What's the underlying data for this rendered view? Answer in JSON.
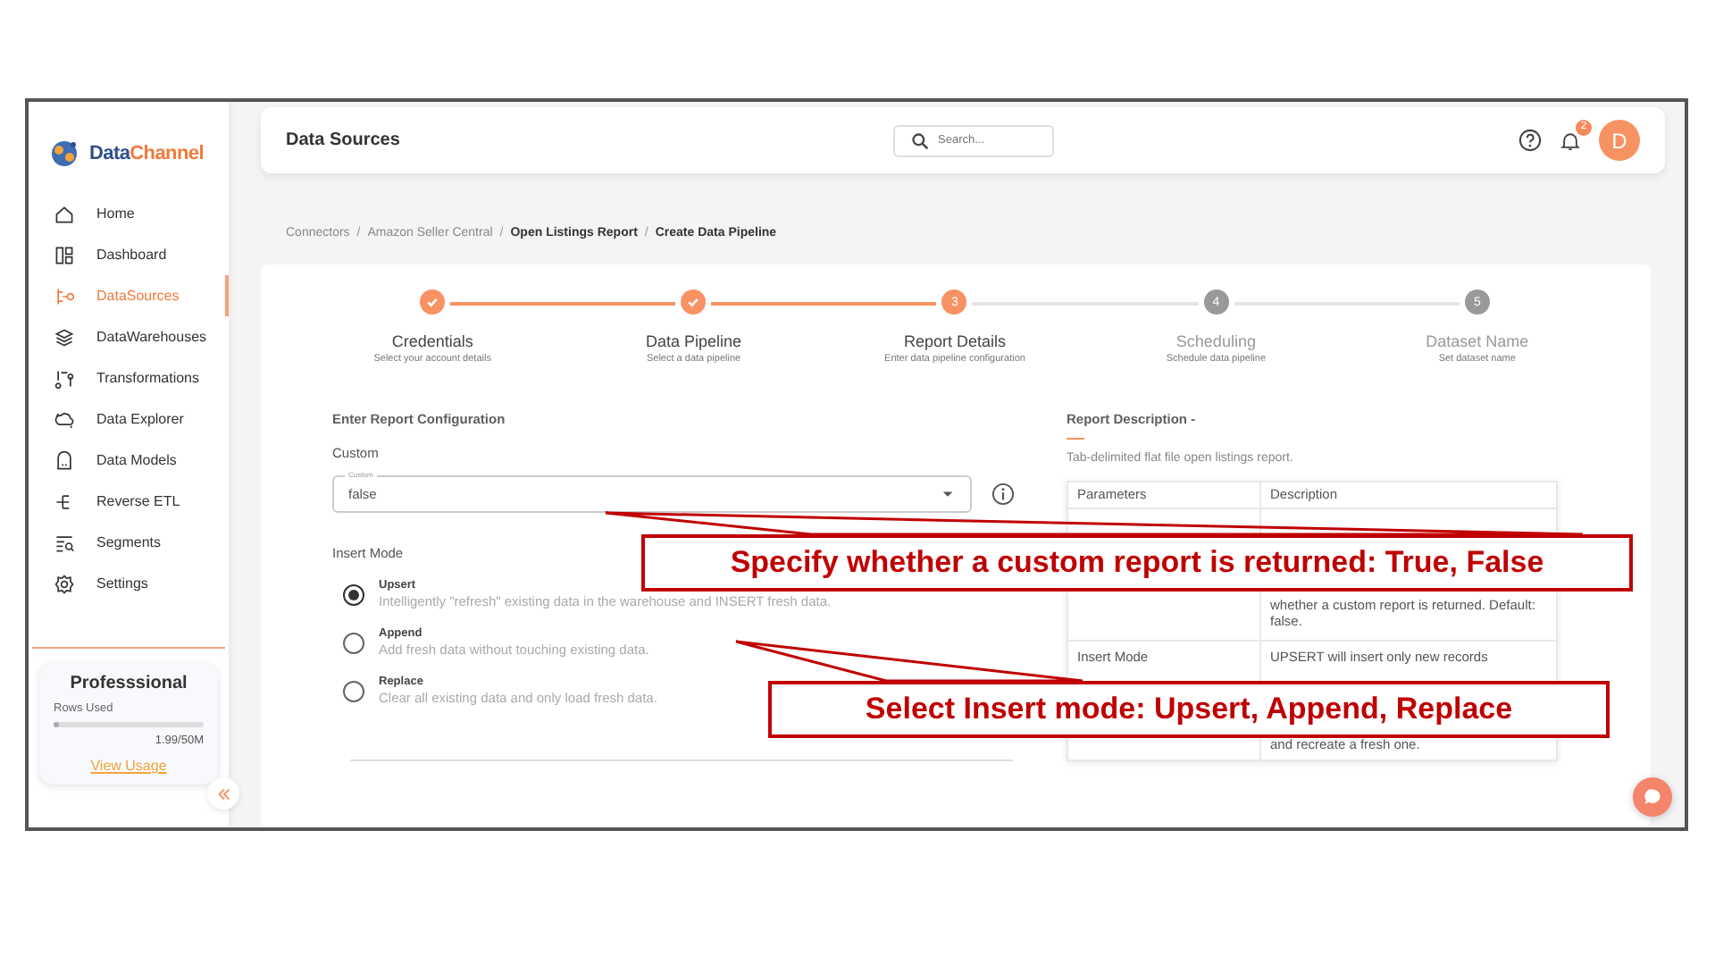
{
  "sidebar": {
    "logo": {
      "first": "Data",
      "second": "Channel"
    },
    "items": [
      {
        "label": "Home",
        "selected": false
      },
      {
        "label": "Dashboard",
        "selected": false
      },
      {
        "label": "DataSources",
        "selected": true
      },
      {
        "label": "DataWarehouses",
        "selected": false
      },
      {
        "label": "Transformations",
        "selected": false
      },
      {
        "label": "Data Explorer",
        "selected": false
      },
      {
        "label": "Data Models",
        "selected": false
      },
      {
        "label": "Reverse ETL",
        "selected": false
      },
      {
        "label": "Segments",
        "selected": false
      },
      {
        "label": "Settings",
        "selected": false
      }
    ],
    "plan": {
      "name": "Professsional",
      "rows_label": "Rows Used",
      "level": 0.04,
      "usage": "1.99/50M",
      "link": "View Usage"
    }
  },
  "header": {
    "title": "Data Sources",
    "search": {
      "placeholder": "Search..."
    },
    "notifications": "2",
    "avatar": "D"
  },
  "breadcrumb": [
    {
      "label": "Connectors",
      "emphasis": false
    },
    {
      "separator": "/",
      "label": "Amazon Seller Central",
      "emphasis": false
    },
    {
      "separator": "/",
      "label": "Open Listings Report",
      "emphasis": true
    },
    {
      "separator": "/",
      "label": "Create Data Pipeline",
      "emphasis": true
    }
  ],
  "steps": [
    {
      "completed": true,
      "reached": true,
      "title": "Credentials",
      "subtitle": "Select your account details"
    },
    {
      "completed": true,
      "reached": true,
      "title": "Data Pipeline",
      "subtitle": "Select a data pipeline"
    },
    {
      "completed": false,
      "reached": true,
      "number": "3",
      "title": "Report Details",
      "subtitle": "Enter data pipeline configuration"
    },
    {
      "completed": false,
      "reached": false,
      "number": "4",
      "title": "Scheduling",
      "subtitle": "Schedule data pipeline"
    },
    {
      "completed": false,
      "reached": false,
      "number": "5",
      "title": "Dataset Name",
      "subtitle": "Set dataset name"
    }
  ],
  "form": {
    "heading": "Enter Report Configuration",
    "custom_label": "Custom",
    "select": {
      "label": "Custom",
      "value": "false"
    },
    "insert_mode_label": "Insert Mode",
    "options": [
      {
        "title": "Upsert",
        "description": "Intelligently \"refresh\" existing data in the warehouse and INSERT fresh data.",
        "selected": true
      },
      {
        "title": "Append",
        "description": "Add fresh data without touching existing data.",
        "selected": false
      },
      {
        "title": "Replace",
        "description": "Clear all existing data and only load fresh data.",
        "selected": false
      }
    ]
  },
  "report": {
    "heading": "Report Description -",
    "text": "Tab-delimited flat file open listings report.",
    "table": {
      "columns": [
        "Parameters",
        "Description"
      ],
      "rows": [
        {
          "description": "whether a custom report is returned. Default: false."
        },
        {
          "parameter": "Insert Mode",
          "description_top": "UPSERT will insert only new records",
          "description_bottom": "and recreate a fresh one."
        }
      ]
    }
  },
  "callouts": [
    {
      "text": "Specify whether a custom report is returned: True, False"
    },
    {
      "text": "Select Insert mode: Upsert, Append, Replace"
    }
  ]
}
